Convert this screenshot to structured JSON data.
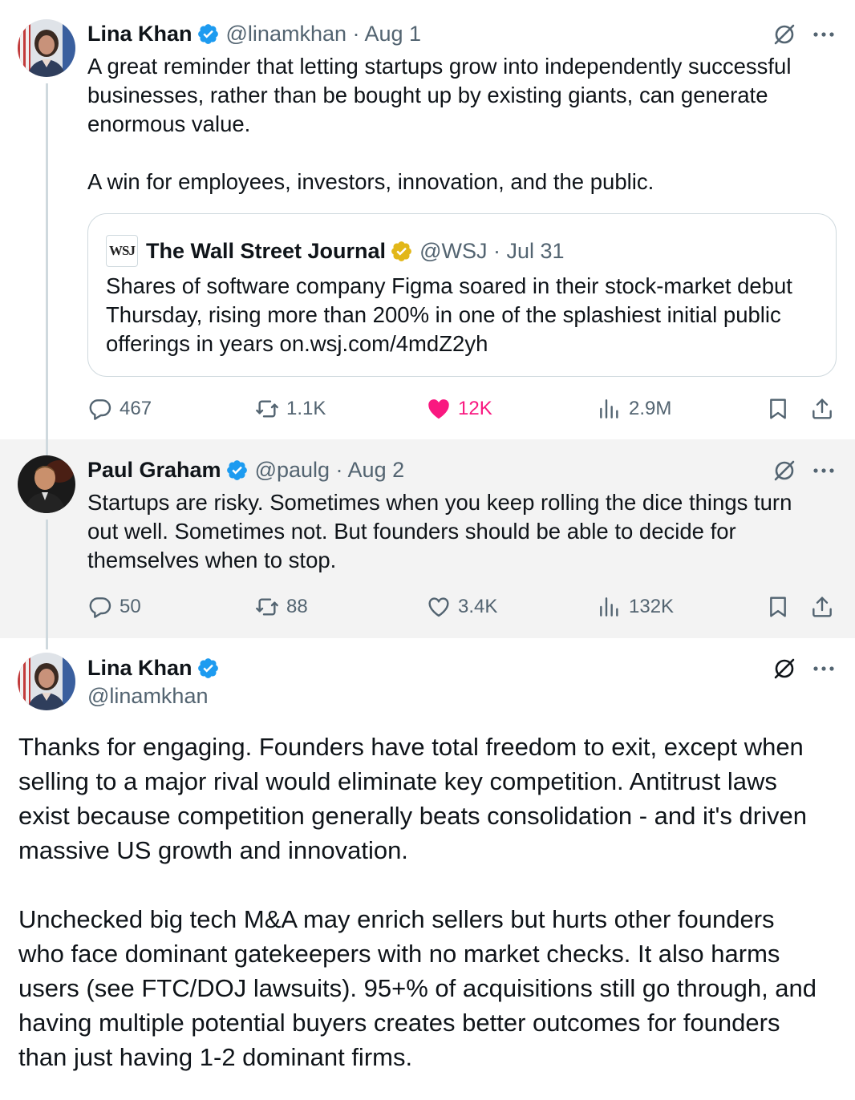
{
  "colors": {
    "verified_blue": "#1d9bf0",
    "verified_gold": "#e2b719",
    "like_pink": "#f91880",
    "meta_gray": "#536471",
    "thread_line": "#cfd9de",
    "highlight_bg": "#f3f3f3"
  },
  "tweet1": {
    "author_name": "Lina Khan",
    "verified_icon": "verified-blue-check",
    "handle": "@linamkhan",
    "date": "Aug 1",
    "meta": "@linamkhan · Aug 1",
    "text_lines": [
      "A great reminder that letting startups grow into independently successful",
      "businesses, rather than be bought up by existing giants, can generate",
      "enormous value."
    ],
    "text_lines_2": [
      "A win for employees, investors, innovation, and the public."
    ],
    "quote": {
      "logo_text": "WSJ",
      "author_name": "The Wall Street Journal",
      "verified_icon": "verified-gold-check",
      "meta": "@WSJ · Jul 31",
      "text_lines": [
        "Shares of software company Figma soared in their stock-market debut",
        "Thursday, rising more than 200% in one of the splashiest initial public",
        "offerings in years on.wsj.com/4mdZ2yh"
      ]
    },
    "stats": {
      "replies": "467",
      "reposts": "1.1K",
      "likes": "12K",
      "liked": true,
      "views": "2.9M"
    }
  },
  "tweet2": {
    "author_name": "Paul Graham",
    "verified_icon": "verified-blue-check",
    "handle": "@paulg",
    "date": "Aug 2",
    "meta": "@paulg · Aug 2",
    "text_lines": [
      "Startups are risky. Sometimes when you keep rolling the dice things turn",
      "out well. Sometimes not. But founders should be able to decide for",
      "themselves when to stop."
    ],
    "stats": {
      "replies": "50",
      "reposts": "88",
      "likes": "3.4K",
      "liked": false,
      "views": "132K"
    }
  },
  "tweet3": {
    "author_name": "Lina Khan",
    "verified_icon": "verified-blue-check",
    "handle": "@linamkhan",
    "paragraph1": [
      "Thanks for engaging. Founders have total freedom to exit, except when",
      "selling to a major rival would eliminate key competition. Antitrust laws",
      "exist because competition generally beats consolidation - and it's driven",
      "massive US growth and innovation."
    ],
    "paragraph2": [
      "Unchecked big tech M&A may enrich sellers but hurts other founders",
      "who face dominant gatekeepers with no market checks. It also harms",
      "users (see FTC/DOJ lawsuits). 95+% of acquisitions still go through, and",
      "having multiple potential buyers creates better outcomes for founders",
      "than just having 1-2 dominant firms."
    ]
  }
}
